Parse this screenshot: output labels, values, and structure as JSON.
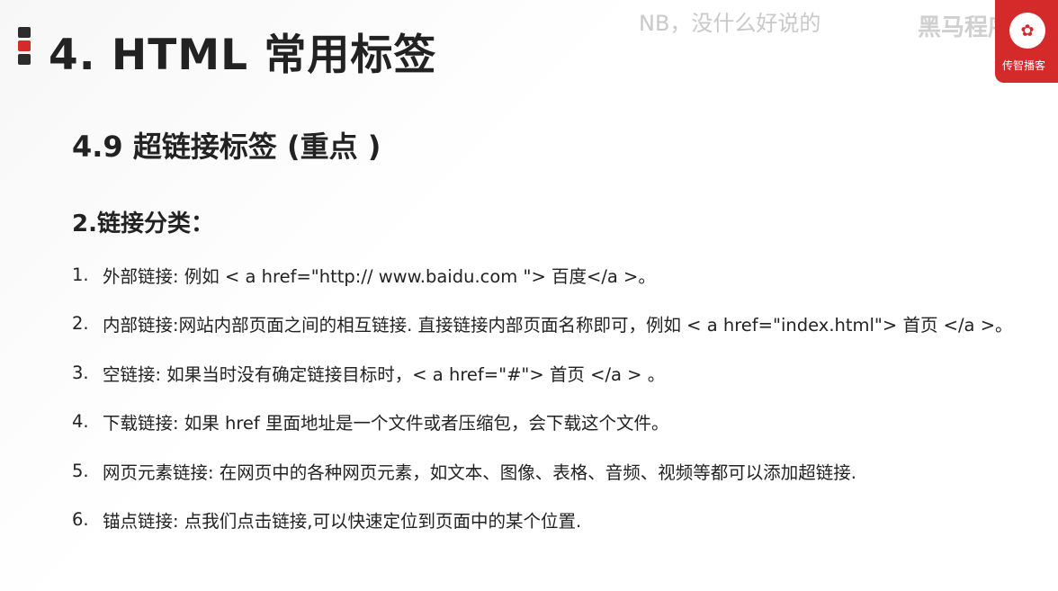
{
  "header": {
    "title": "4. HTML 常用标签",
    "overlay_comment": "NB，没什么好说的",
    "overlay_brand": "黑马程序员",
    "logo_text": "传智播客"
  },
  "section": {
    "title": "4.9 超链接标签 (重点 )",
    "subtitle": "2.链接分类："
  },
  "items": [
    {
      "num": "1.",
      "text": "外部链接: 例如 < a href=\"http:// www.baidu.com \"> 百度</a >。"
    },
    {
      "num": "2.",
      "text": "内部链接:网站内部页面之间的相互链接. 直接链接内部页面名称即可，例如 < a href=\"index.html\"> 首页 </a >。"
    },
    {
      "num": "3.",
      "text": "空链接: 如果当时没有确定链接目标时，< a href=\"#\"> 首页 </a > 。"
    },
    {
      "num": "4.",
      "text": "下载链接: 如果 href 里面地址是一个文件或者压缩包，会下载这个文件。"
    },
    {
      "num": "5.",
      "text": "网页元素链接: 在网页中的各种网页元素，如文本、图像、表格、音频、视频等都可以添加超链接."
    },
    {
      "num": "6.",
      "text": "锚点链接: 点我们点击链接,可以快速定位到页面中的某个位置."
    }
  ]
}
